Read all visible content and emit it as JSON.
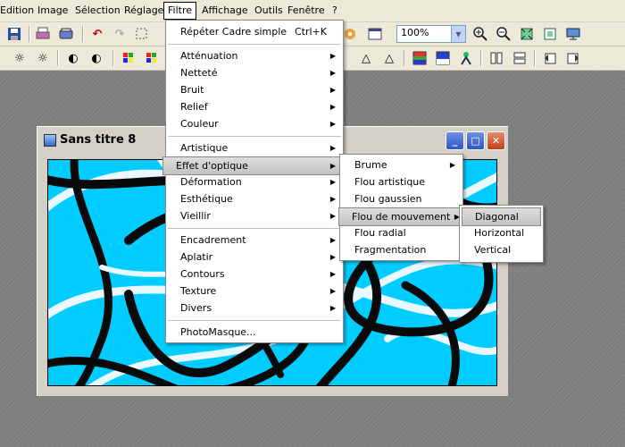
{
  "menubar": {
    "items": [
      "Edition",
      "Image",
      "Sélection",
      "Réglage",
      "Filtre",
      "Affichage",
      "Outils",
      "Fenêtre",
      "?"
    ]
  },
  "toolbar": {
    "zoom_value": "100%"
  },
  "document": {
    "title": "Sans titre 8",
    "minimize": "_",
    "maximize": "□",
    "close": "✕"
  },
  "filter_menu": {
    "repeat_label": "Répéter Cadre simple",
    "repeat_shortcut": "Ctrl+K",
    "groups": [
      [
        "Atténuation",
        "Netteté",
        "Bruit",
        "Relief",
        "Couleur"
      ],
      [
        "Artistique",
        "Effet d'optique",
        "Déformation",
        "Esthétique",
        "Vieillir"
      ],
      [
        "Encadrement",
        "Aplatir",
        "Contours",
        "Texture",
        "Divers"
      ]
    ],
    "photomasque": "PhotoMasque..."
  },
  "optique_menu": {
    "items": [
      "Brume",
      "Flou artistique",
      "Flou gaussien",
      "Flou de mouvement",
      "Flou radial",
      "Fragmentation"
    ]
  },
  "motion_menu": {
    "items": [
      "Diagonal",
      "Horizontal",
      "Vertical"
    ]
  },
  "colors": {
    "canvas_bg": "#00ccff",
    "stroke_dark": "#111111",
    "stroke_light": "#e8f8ff"
  }
}
